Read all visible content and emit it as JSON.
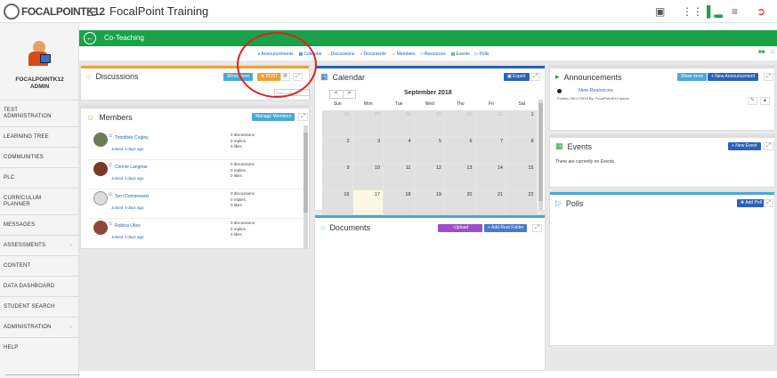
{
  "app": {
    "logo_text": "FOCALPOINTK12",
    "title": "FocalPoint Training"
  },
  "topbar_icons": [
    "id-card-icon",
    "grid-icon",
    "bars-chart-icon",
    "list-icon",
    "logout-icon"
  ],
  "sidebar": {
    "username_line1": "FOCALPOINTK12",
    "username_line2": "ADMIN",
    "items": [
      {
        "label": "TEST",
        "label2": "ADMINISTRATION"
      },
      {
        "label": "LEARNING TREE"
      },
      {
        "label": "COMMUNITIES"
      },
      {
        "label": "PLC"
      },
      {
        "label": "CURRICULUM",
        "label2": "PLANNER"
      },
      {
        "label": "MESSAGES"
      },
      {
        "label": "ASSESSMENTS",
        "chevron": "›"
      },
      {
        "label": "CONTENT"
      },
      {
        "label": "DATA DASHBOARD"
      },
      {
        "label": "STUDENT SEARCH"
      },
      {
        "label": "ADMINISTRATION",
        "chevron": "›"
      },
      {
        "label": "HELP"
      }
    ]
  },
  "greenbar": {
    "title": "Co-Teaching"
  },
  "tabs": [
    "Announcements",
    "Calendar",
    "Discussions",
    "Documents",
    "Members",
    "Resources",
    "Events",
    "Polls"
  ],
  "discussions": {
    "title": "Discussions",
    "show_more": "Show more",
    "post": "POST",
    "search_placeholder": "Start a new di..."
  },
  "members": {
    "title": "Members",
    "manage": "Manage Members",
    "list": [
      {
        "name": "Timothée Cogley",
        "joined": "Joined 4 days ago",
        "discussions": "0 discussions",
        "replies": "0 replies",
        "likes": "0 likes"
      },
      {
        "name": "Connie Langmar",
        "joined": "Joined 4 days ago",
        "discussions": "0 discussions",
        "replies": "0 replies",
        "likes": "0 likes"
      },
      {
        "name": "Terri Dominowski",
        "joined": "Joined 4 days ago",
        "discussions": "0 discussions",
        "replies": "0 replies",
        "likes": "0 likes"
      },
      {
        "name": "Robina Ukes",
        "joined": "Joined 4 days ago",
        "discussions": "0 discussions",
        "replies": "0 replies",
        "likes": "0 likes"
      }
    ]
  },
  "calendar": {
    "title": "Calendar",
    "export": "Export",
    "month": "September 2018",
    "prev": "<",
    "next": ">",
    "days": [
      "Sun",
      "Mon",
      "Tue",
      "Wed",
      "Thu",
      "Fri",
      "Sat"
    ],
    "weeks": [
      [
        "26",
        "27",
        "28",
        "29",
        "30",
        "31",
        "1"
      ],
      [
        "2",
        "3",
        "4",
        "5",
        "6",
        "7",
        "8"
      ],
      [
        "9",
        "10",
        "11",
        "12",
        "13",
        "14",
        "15"
      ],
      [
        "16",
        "17",
        "18",
        "19",
        "20",
        "21",
        "22"
      ]
    ]
  },
  "documents": {
    "title": "Documents",
    "upload": "Upload",
    "add_folder": "+ Add Root Folder"
  },
  "announcements": {
    "title": "Announcements",
    "show_more": "Show more",
    "new": "+ New Announcement",
    "item_title": "New Resources",
    "item_meta": "Posted: 09/17/2018   By: FocalPointK12 Admin"
  },
  "events": {
    "title": "Events",
    "new": "+ New Event",
    "empty": "There are currently no Events."
  },
  "polls": {
    "title": "Polls",
    "add": "Add Poll"
  },
  "colors": {
    "green": "#1aa14a",
    "blue": "#2a63b5",
    "orange": "#f0a030",
    "purple": "#9b4fc7",
    "highlight": "#e0221d"
  }
}
